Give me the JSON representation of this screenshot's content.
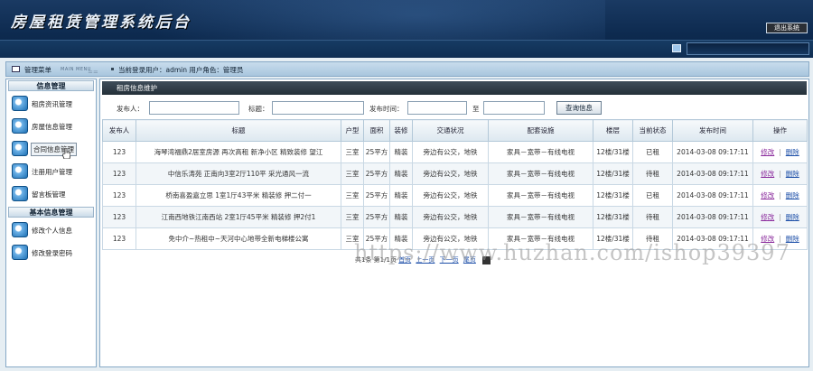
{
  "header": {
    "title": "房屋租赁管理系统后台",
    "logout_label": "退出系统"
  },
  "infobar": {
    "menu_label": "管理菜单",
    "menu_label_en": "MAIN MENU",
    "divider": "==",
    "user_text": "当前登录用户：admin  用户角色：管理员"
  },
  "sidebar": {
    "sections": [
      {
        "title": "信息管理",
        "items": [
          {
            "label": "租房资讯管理",
            "icon": "globe-icon"
          },
          {
            "label": "房屋信息管理",
            "icon": "globe-icon"
          },
          {
            "label": "合同信息管理",
            "icon": "globe-icon",
            "active": true
          },
          {
            "label": "注册用户管理",
            "icon": "globe-icon"
          },
          {
            "label": "留言板管理",
            "icon": "globe-icon"
          }
        ]
      },
      {
        "title": "基本信息管理",
        "items": [
          {
            "label": "修改个人信息",
            "icon": "globe-icon"
          },
          {
            "label": "修改登录密码",
            "icon": "globe-icon"
          }
        ]
      }
    ]
  },
  "main": {
    "panel_title": "租房信息维护",
    "filter": {
      "publisher_label": "发布人：",
      "title_label": "标题：",
      "time_label": "发布时间：",
      "to_label": "至",
      "query_label": "查询信息"
    },
    "columns": [
      "发布人",
      "标题",
      "户型",
      "面积",
      "装修",
      "交通状况",
      "配套设施",
      "楼层",
      "当前状态",
      "发布时间",
      "操作"
    ],
    "rows": [
      [
        "123",
        "海琴湾福鼎2居室房源 再次高租 新净小区 精致装修 望江",
        "三室",
        "25平方",
        "精装",
        "旁边有公交，地铁",
        "家具－宽带－有线电视",
        "12楼/31楼",
        "已租",
        "2014-03-08 09:17:11"
      ],
      [
        "123",
        "中信乐涛苑 正南向3室2厅110平 采光通风一流",
        "三室",
        "25平方",
        "精装",
        "旁边有公交，地铁",
        "家具－宽带－有线电视",
        "12楼/31楼",
        "待租",
        "2014-03-08 09:17:11"
      ],
      [
        "123",
        "桥南喜盈嘉立思 1室1厅43平米 精装修 押二付一",
        "三室",
        "25平方",
        "精装",
        "旁边有公交，地铁",
        "家具－宽带－有线电视",
        "12楼/31楼",
        "已租",
        "2014-03-08 09:17:11"
      ],
      [
        "123",
        "江南西地铁江南西站 2室1厅45平米 精装修 押2付1",
        "三室",
        "25平方",
        "精装",
        "旁边有公交，地铁",
        "家具－宽带－有线电视",
        "12楼/31楼",
        "待租",
        "2014-03-08 09:17:11"
      ],
      [
        "123",
        "免中介~热租中~天河中心地带全新电梯楼公寓",
        "三室",
        "25平方",
        "精装",
        "旁边有公交，地铁",
        "家具－宽带－有线电视",
        "12楼/31楼",
        "待租",
        "2014-03-08 09:17:11"
      ]
    ],
    "ops": {
      "edit": "修改",
      "sep": "|",
      "delete": "删除"
    },
    "pager": {
      "summary": "共1条 第1/1页",
      "first": "首页",
      "prev": "上一页",
      "next": "下一页",
      "last": "尾页"
    }
  },
  "watermark": "https://www.huzhan.com/ishop39397"
}
